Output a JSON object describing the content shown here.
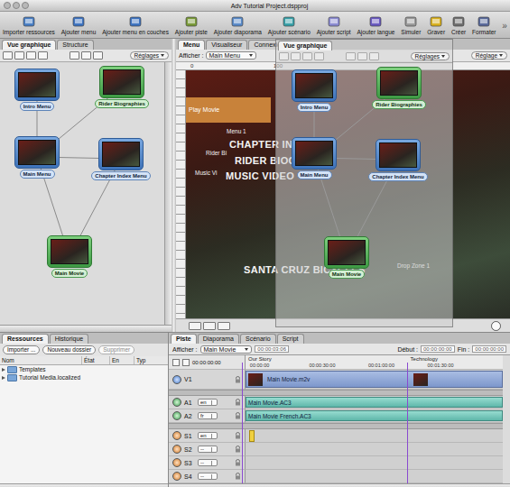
{
  "window": {
    "title": "Adv Tutorial Project.dspproj"
  },
  "toolbar": {
    "items": [
      {
        "label": "Importer ressources"
      },
      {
        "label": "Ajouter menu"
      },
      {
        "label": "Ajouter menu en couches"
      },
      {
        "label": "Ajouter piste"
      },
      {
        "label": "Ajouter diaporama"
      },
      {
        "label": "Ajouter scénario"
      },
      {
        "label": "Ajouter script"
      },
      {
        "label": "Ajouter langue"
      },
      {
        "label": "Simuler"
      },
      {
        "label": "Graver"
      },
      {
        "label": "Créer"
      },
      {
        "label": "Formater"
      }
    ],
    "overflow": "»"
  },
  "graph": {
    "tabs": [
      {
        "label": "Vue graphique",
        "selected": true
      },
      {
        "label": "Structure",
        "selected": false
      }
    ],
    "settings": "Réglages",
    "nodes": [
      {
        "label": "Intro Menu",
        "kind": "menu"
      },
      {
        "label": "Rider Biographies",
        "kind": "track"
      },
      {
        "label": "Main Menu",
        "kind": "menu"
      },
      {
        "label": "Chapter Index Menu",
        "kind": "menu"
      },
      {
        "label": "Main Movie",
        "kind": "track"
      }
    ],
    "connections": [
      {
        "from": "Intro Menu",
        "to": "Main Menu"
      },
      {
        "from": "Rider Biographies",
        "to": "Main Menu"
      },
      {
        "from": "Main Menu",
        "to": "Chapter Index Menu"
      },
      {
        "from": "Main Menu",
        "to": "Main Movie"
      },
      {
        "from": "Chapter Index Menu",
        "to": "Main Movie"
      }
    ]
  },
  "floating_window": {
    "tab": {
      "label": "Vue graphique",
      "selected": true
    },
    "settings": "Réglages"
  },
  "menu_editor": {
    "tabs": [
      {
        "label": "Menu",
        "selected": true
      },
      {
        "label": "Visualiseur",
        "selected": false
      },
      {
        "label": "Connexions",
        "selected": false
      }
    ],
    "show_label": "Afficher :",
    "show_value": "Main Menu",
    "settings": "Réglage",
    "ruler": [
      "0",
      "100"
    ],
    "items": [
      {
        "label": "Play Movie",
        "kind": "button",
        "selected": true
      },
      {
        "label": "Menu 1",
        "kind": "button",
        "selected": false
      },
      {
        "label": "CHAPTER INDEX",
        "kind": "title",
        "selected": false
      },
      {
        "label": "Rider Bi",
        "kind": "button",
        "selected": false
      },
      {
        "label": "RIDER BIOGR",
        "kind": "title",
        "selected": false
      },
      {
        "label": "Music Vi",
        "kind": "button",
        "selected": false
      },
      {
        "label": "MUSIC VIDEO",
        "kind": "title",
        "selected": false
      },
      {
        "label": "SANTA CRUZ BICYCLES",
        "kind": "title",
        "selected": false
      },
      {
        "label": "Drop Zone 1",
        "kind": "zone",
        "selected": false
      }
    ]
  },
  "assets": {
    "tabs": [
      {
        "label": "Ressources",
        "selected": true
      },
      {
        "label": "Historique",
        "selected": false
      }
    ],
    "buttons": [
      {
        "label": "Importer ...",
        "disabled": false
      },
      {
        "label": "Nouveau dossier",
        "disabled": false
      },
      {
        "label": "Supprimer",
        "disabled": true
      }
    ],
    "columns": [
      "Nom",
      "État",
      "En",
      "Typ"
    ],
    "rows": [
      {
        "name": "Templates",
        "expanded": false
      },
      {
        "name": "Tutorial Media.localized",
        "expanded": false
      }
    ]
  },
  "timeline": {
    "tabs": [
      {
        "label": "Piste",
        "selected": true
      },
      {
        "label": "Diaporama",
        "selected": false
      },
      {
        "label": "Scénario",
        "selected": false
      },
      {
        "label": "Script",
        "selected": false
      }
    ],
    "show_label": "Afficher :",
    "show_value": "Main Movie",
    "timecode": "00:00:03:06",
    "start_label": "Début :",
    "start_value": "00:00:00:00",
    "end_label": "Fin :",
    "end_value": "00:00:00:00",
    "position": "00:00:00:00",
    "markers": [
      {
        "label": "Our Story"
      },
      {
        "label": "Technology"
      }
    ],
    "ruler": [
      "00:00:00",
      "00:00:30:00",
      "00:01:00:00",
      "00:01:30:00"
    ],
    "tracks": [
      {
        "id": "V1",
        "kind": "video",
        "clips": [
          {
            "kind": "clip",
            "label": "Main Movie.m2v"
          }
        ]
      },
      {
        "id": "A1",
        "kind": "audio",
        "lang": "en",
        "clips": [
          {
            "kind": "clip",
            "label": "Main Movie.AC3"
          }
        ]
      },
      {
        "id": "A2",
        "kind": "audio",
        "lang": "fr",
        "clips": [
          {
            "kind": "clip",
            "label": "Main Movie French.AC3"
          }
        ]
      },
      {
        "id": "S1",
        "kind": "subtitle",
        "lang": "en",
        "clips": [
          {
            "kind": "cue"
          }
        ]
      },
      {
        "id": "S2",
        "kind": "subtitle",
        "lang": "--",
        "clips": []
      },
      {
        "id": "S3",
        "kind": "subtitle",
        "lang": "--",
        "clips": []
      },
      {
        "id": "S4",
        "kind": "subtitle",
        "lang": "--",
        "clips": []
      }
    ]
  }
}
